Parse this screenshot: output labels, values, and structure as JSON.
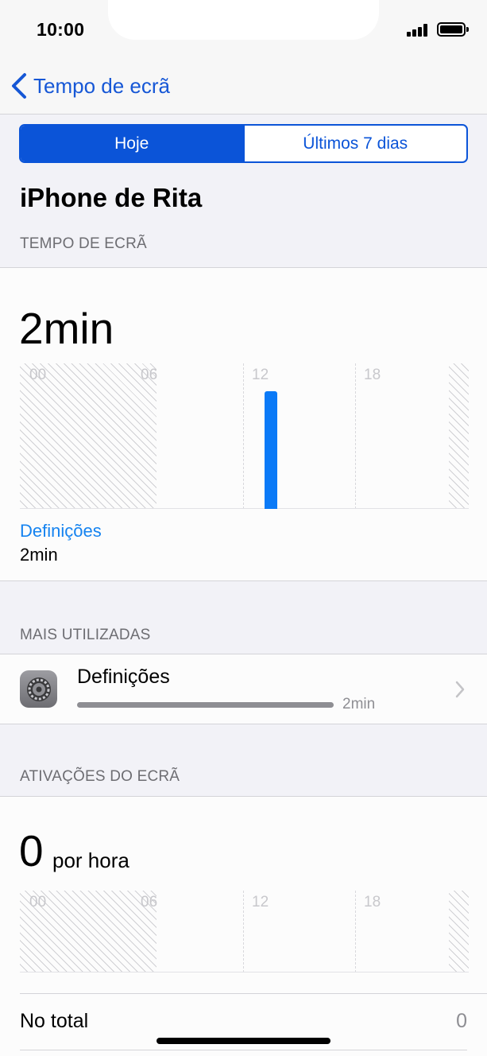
{
  "status_bar": {
    "time": "10:00"
  },
  "nav": {
    "back_label": "Tempo de ecrã"
  },
  "segmented": {
    "today": "Hoje",
    "last7": "Últimos 7 dias",
    "selected": "Hoje"
  },
  "device_title": "iPhone de Rita",
  "screen_time": {
    "header": "TEMPO DE ECRÃ",
    "total": "2min",
    "ticks": [
      "00",
      "06",
      "12",
      "18"
    ],
    "legend_app": "Definições",
    "legend_value": "2min"
  },
  "most_used": {
    "header": "MAIS UTILIZADAS",
    "items": [
      {
        "name": "Definições",
        "time": "2min",
        "icon": "settings-gear-icon"
      }
    ]
  },
  "pickups": {
    "header": "ATIVAÇÕES DO ECRÃ",
    "value": "0",
    "unit": "por hora",
    "ticks": [
      "00",
      "06",
      "12",
      "18"
    ],
    "total_label": "No total",
    "total_value": "0"
  },
  "chart_data": [
    {
      "type": "bar",
      "categories": [
        "00",
        "06",
        "12",
        "18"
      ],
      "series": [
        {
          "name": "Definições",
          "values": [
            0,
            0,
            2,
            0
          ]
        }
      ],
      "ylabel": "min",
      "color": "#0a7af7"
    },
    {
      "type": "bar",
      "categories": [
        "00",
        "06",
        "12",
        "18"
      ],
      "series": [
        {
          "values": [
            0,
            0,
            0,
            0
          ]
        }
      ]
    }
  ]
}
